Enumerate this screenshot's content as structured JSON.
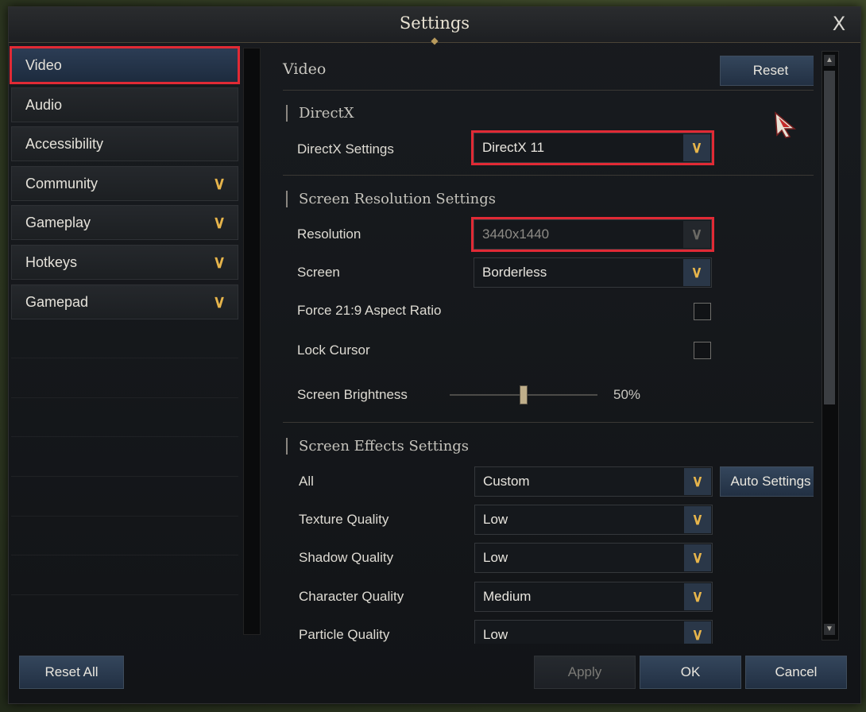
{
  "window": {
    "title": "Settings",
    "close_label": "X"
  },
  "nav": {
    "items": [
      {
        "label": "Video",
        "active": true,
        "expandable": false
      },
      {
        "label": "Audio",
        "active": false,
        "expandable": false
      },
      {
        "label": "Accessibility",
        "active": false,
        "expandable": false
      },
      {
        "label": "Community",
        "active": false,
        "expandable": true
      },
      {
        "label": "Gameplay",
        "active": false,
        "expandable": true
      },
      {
        "label": "Hotkeys",
        "active": false,
        "expandable": true
      },
      {
        "label": "Gamepad",
        "active": false,
        "expandable": true
      }
    ],
    "chevron_icon": "chevron-down-icon"
  },
  "video": {
    "heading": "Video",
    "reset_label": "Reset",
    "directx": {
      "title": "DirectX",
      "settings_label": "DirectX Settings",
      "settings_value": "DirectX 11"
    },
    "resolution": {
      "title": "Screen Resolution Settings",
      "resolution_label": "Resolution",
      "resolution_value": "3440x1440",
      "screen_label": "Screen",
      "screen_value": "Borderless",
      "force_label": "Force 21:9 Aspect Ratio",
      "force_checked": false,
      "lock_label": "Lock Cursor",
      "lock_checked": false,
      "brightness_label": "Screen Brightness",
      "brightness_value": "50%",
      "brightness_fraction": 0.5
    },
    "effects": {
      "title": "Screen Effects Settings",
      "all_label": "All",
      "all_value": "Custom",
      "auto_label": "Auto Settings",
      "texture_label": "Texture Quality",
      "texture_value": "Low",
      "shadow_label": "Shadow Quality",
      "shadow_value": "Low",
      "character_label": "Character Quality",
      "character_value": "Medium",
      "particle_label": "Particle Quality",
      "particle_value": "Low"
    }
  },
  "footer": {
    "reset_all_label": "Reset All",
    "apply_label": "Apply",
    "ok_label": "OK",
    "cancel_label": "Cancel"
  },
  "colors": {
    "accent_gold": "#e7b54b",
    "highlight_red": "#e12a35",
    "active_blue": "#2c3d55"
  }
}
